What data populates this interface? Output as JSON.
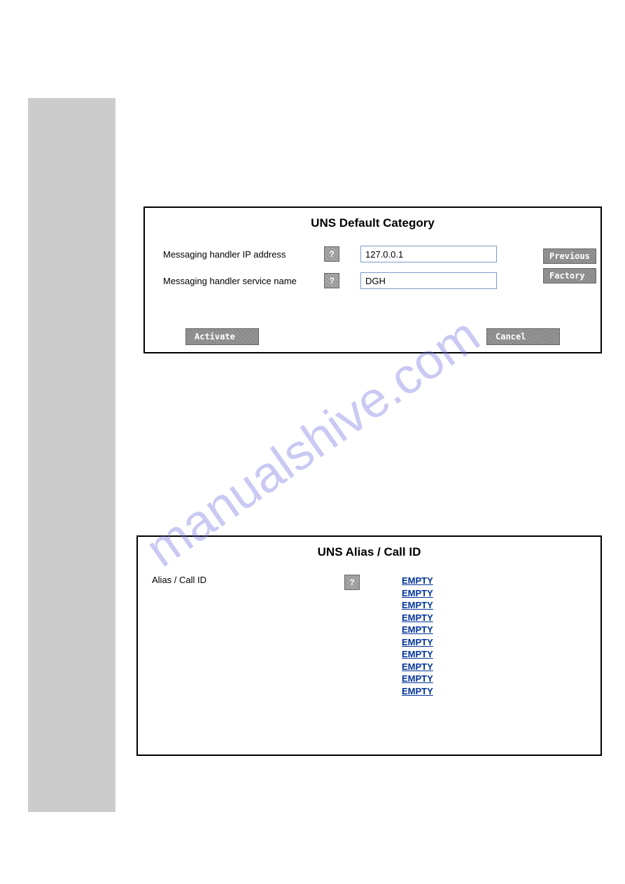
{
  "watermark": "manualshive.com",
  "panel1": {
    "title": "UNS Default Category",
    "field1_label": "Messaging handler IP address",
    "field1_value": "127.0.0.1",
    "field2_label": "Messaging handler service name",
    "field2_value": "DGH",
    "help_label": "?",
    "previous_label": "Previous",
    "factory_label": "Factory",
    "activate_label": "Activate",
    "cancel_label": "Cancel"
  },
  "panel2": {
    "title": "UNS Alias / Call ID",
    "field_label": "Alias / Call ID",
    "help_label": "?",
    "items": [
      "EMPTY",
      "EMPTY",
      "EMPTY",
      "EMPTY",
      "EMPTY",
      "EMPTY",
      "EMPTY",
      "EMPTY",
      "EMPTY",
      "EMPTY"
    ]
  }
}
